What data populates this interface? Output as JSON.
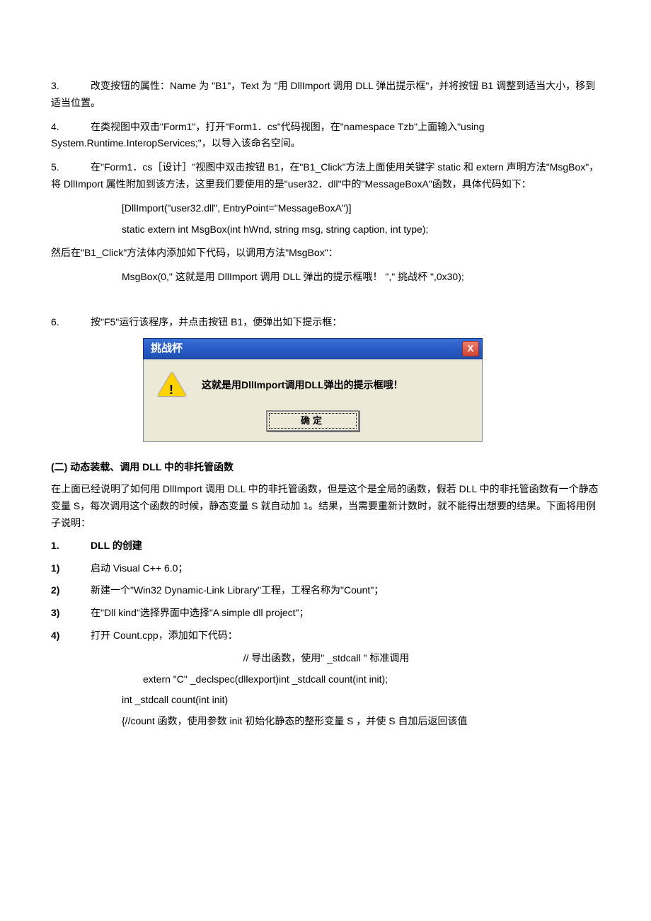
{
  "s3": {
    "num": "3.",
    "text": "改变按钮的属性：Name 为 \"B1\"，Text 为 \"用 DllImport 调用 DLL 弹出提示框\"，并将按钮 B1 调整到适当大小，移到适当位置。"
  },
  "s4": {
    "num": "4.",
    "text": "在类视图中双击\"Form1\"，打开\"Form1．cs\"代码视图，在\"namespace Tzb\"上面输入\"using System.Runtime.InteropServices;\"，以导入该命名空间。"
  },
  "s5": {
    "num": "5.",
    "text": "在\"Form1．cs［设计］\"视图中双击按钮 B1，在\"B1_Click\"方法上面使用关键字 static 和 extern 声明方法\"MsgBox\"，将 DllImport 属性附加到该方法，这里我们要使用的是\"user32．dll\"中的\"MessageBoxA\"函数，具体代码如下："
  },
  "code1_a": "[DllImport(\"user32.dll\", EntryPoint=\"MessageBoxA\")]",
  "code1_b": "static extern int MsgBox(int hWnd, string msg, string caption, int type);",
  "then": "然后在\"B1_Click\"方法体内添加如下代码，以调用方法\"MsgBox\"：",
  "code2": "MsgBox(0,\" 这就是用 DllImport 调用 DLL 弹出的提示框哦！ \",\" 挑战杯 \",0x30);",
  "s6": {
    "num": "6.",
    "text": "按\"F5\"运行该程序，并点击按钮 B1，便弹出如下提示框："
  },
  "dlg": {
    "title": "挑战杯",
    "close": "X",
    "msg": "这就是用DllImport调用DLL弹出的提示框哦！",
    "ok": "确定"
  },
  "sec2": {
    "h": "(二)      动态装载、调用 DLL 中的非托管函数",
    "p": "在上面已经说明了如何用 DllImport 调用 DLL 中的非托管函数，但是这个是全局的函数，假若 DLL 中的非托管函数有一个静态变量 S，每次调用这个函数的时候，静态变量 S 就自动加 1。结果，当需要重新计数时，就不能得出想要的结果。下面将用例子说明："
  },
  "h3a": {
    "num": "1.",
    "text": "DLL 的创建"
  },
  "sub1": {
    "num": "1)",
    "text": "启动 Visual C++ 6.0；"
  },
  "sub2": {
    "num": "2)",
    "text": "新建一个\"Win32 Dynamic-Link Library\"工程，工程名称为\"Count\"；"
  },
  "sub3": {
    "num": "3)",
    "text": "在\"Dll kind\"选择界面中选择\"A simple dll project\"；"
  },
  "sub4": {
    "num": "4)",
    "text": "打开 Count.cpp，添加如下代码："
  },
  "c_com": "// 导出函数，使用\" _stdcall \" 标准调用",
  "c_ext": "extern \"C\" _declspec(dllexport)int _stdcall count(int init);",
  "c_fn": "int _stdcall count(int init)",
  "c_body": "{//count 函数，使用参数 init 初始化静态的整形变量 S ，并使 S 自加后返回该值"
}
